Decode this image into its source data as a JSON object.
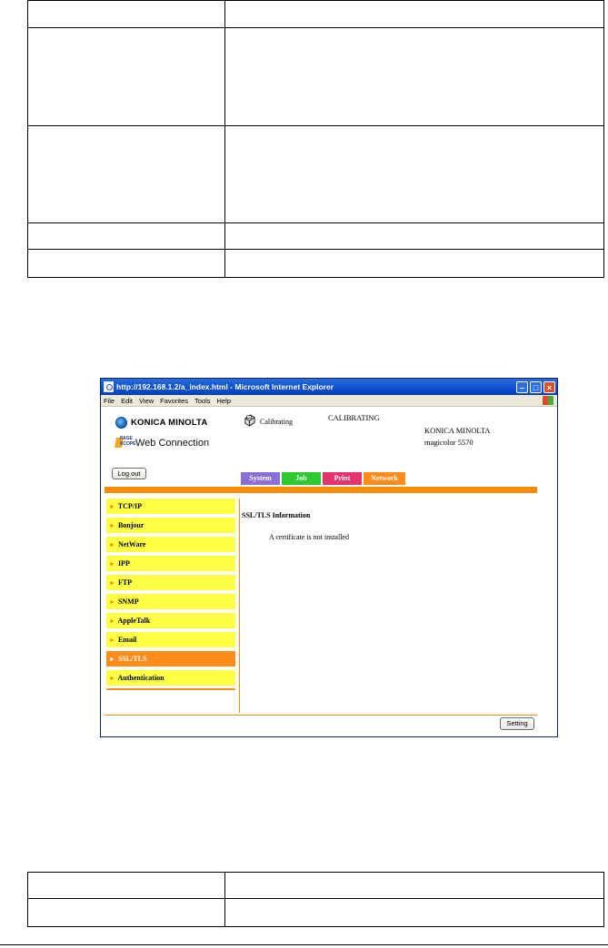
{
  "browser": {
    "title": "http://192.168.1.2/a_index.html - Microsoft Internet Explorer",
    "menu": [
      "File",
      "Edit",
      "View",
      "Favorites",
      "Tools",
      "Help"
    ]
  },
  "header": {
    "brand": "KONICA MINOLTA",
    "pagescope_mark": "PAGE SCOPE",
    "product": "Web Connection",
    "status_label": "Calibrating",
    "status_message": "CALIBRATING",
    "model_line1": "KONICA MINOLTA",
    "model_line2": "magicolor 5570",
    "logout": "Log out"
  },
  "tabs": [
    "System",
    "Job",
    "Print",
    "Network"
  ],
  "sidebar": {
    "items": [
      "TCP/IP",
      "Bonjour",
      "NetWare",
      "IPP",
      "FTP",
      "SNMP",
      "AppleTalk",
      "Email",
      "SSL/TLS",
      "Authentication"
    ],
    "active": "SSL/TLS"
  },
  "main": {
    "section_title": "SSL/TLS Information",
    "message": "A certificate is not installed",
    "setting_button": "Setting"
  },
  "colors": {
    "accent_orange": "#ff8c00",
    "sidebar_yellow": "#ffff44",
    "tab_system": "#8c6fd6",
    "tab_job": "#2ec92e",
    "tab_print": "#e6336e",
    "tab_network": "#ff8c1a"
  }
}
